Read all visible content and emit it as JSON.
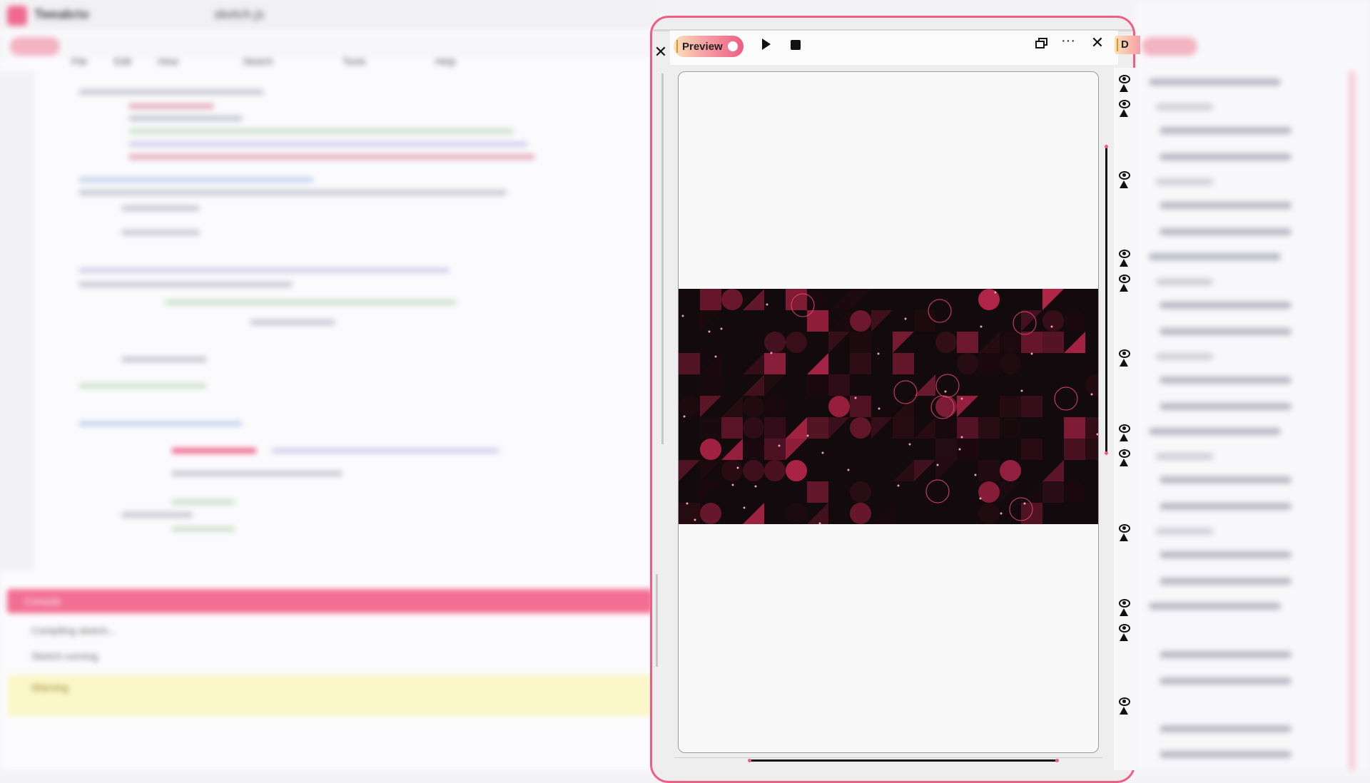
{
  "background_ide": {
    "window_title": "Tweakrio",
    "file_name": "sketch.js",
    "menu": [
      "File",
      "Edit",
      "View",
      "Sketch",
      "Tools",
      "Help"
    ],
    "output_header": "Console",
    "output_lines": [
      "Compiling sketch...",
      "Sketch running"
    ],
    "warning": "Warning"
  },
  "preview": {
    "label": "Preview",
    "close_symbol": "✕",
    "more_symbol": "···"
  },
  "layers_panel": {
    "header_initial": "D",
    "rows": 22
  },
  "colors": {
    "accent": "#ee5d84",
    "accent_gradient_start": "#fbe2b8",
    "artwork_background": "#120a0d",
    "artwork_highlight": "#c3284f"
  },
  "icons": [
    "close-icon",
    "play-icon",
    "stop-icon",
    "window-restore-icon",
    "more-icon",
    "eye-icon",
    "lock-icon"
  ]
}
